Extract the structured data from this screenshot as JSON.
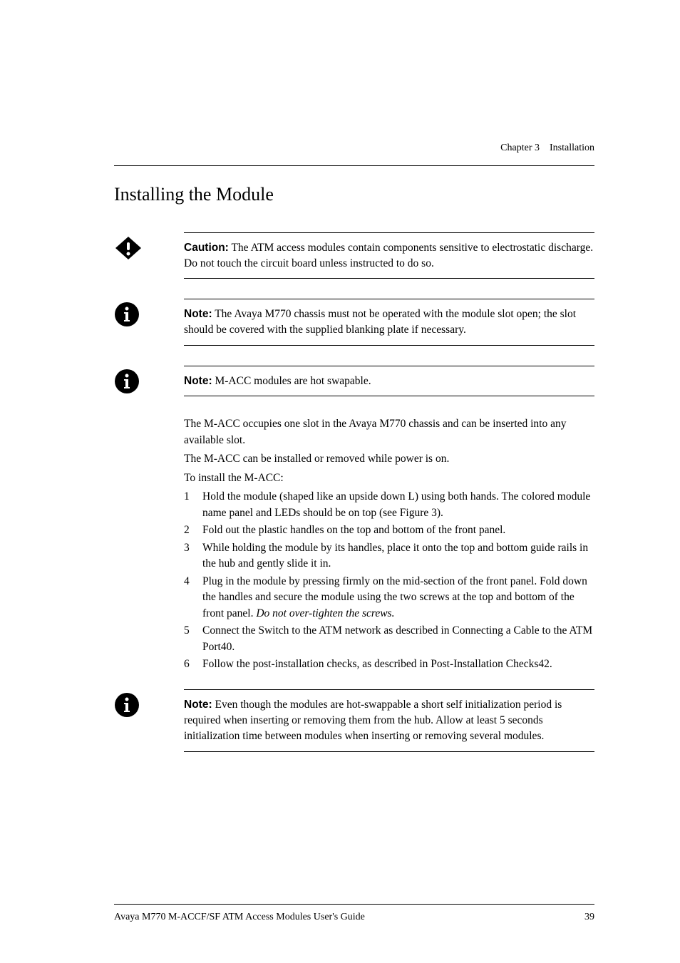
{
  "header": {
    "chapter": "Chapter 3",
    "title": "Installation"
  },
  "section": {
    "title": "Installing the Module"
  },
  "callouts": {
    "caution": {
      "label": "Caution:",
      "text": "The ATM access modules contain components sensitive to electrostatic discharge. Do not touch the circuit board unless instructed to do so."
    },
    "note1": {
      "label": "Note:",
      "text": "The Avaya M770 chassis must not be operated with the module slot open; the slot should be covered with the supplied blanking plate if necessary."
    },
    "note2": {
      "label": "Note:",
      "text": "M-ACC modules are hot swapable."
    },
    "note3": {
      "label": "Note:",
      "text": "Even though the modules are hot-swappable a short self initialization period is required when inserting or removing them from the hub. Allow at least 5 seconds initialization time between modules when inserting or removing several modules."
    }
  },
  "body": {
    "p1": "The M-ACC occupies one slot in the Avaya M770 chassis and can be inserted into any available slot.",
    "p2": "The M-ACC can be installed or removed while power is on.",
    "p3": "To install the M-ACC:"
  },
  "steps": [
    {
      "num": "1",
      "text": "Hold the module (shaped like an upside down L) using both hands. The colored module name panel and LEDs should be on top (see Figure 3)."
    },
    {
      "num": "2",
      "text": "Fold out the plastic handles on the top and bottom of the front panel."
    },
    {
      "num": "3",
      "text": "While holding the module by its handles, place it onto the top and bottom guide rails in the hub and gently slide it in."
    },
    {
      "num": "4",
      "text_a": "Plug in the module by pressing firmly on the mid-section of the front panel. Fold down the handles and secure the module using the two screws at the top and bottom of the front panel. ",
      "italic": "Do not over-tighten the screws."
    },
    {
      "num": "5",
      "text": "Connect the Switch to the ATM network as described in Connecting a Cable to the ATM Port40."
    },
    {
      "num": "6",
      "text": "Follow the post-installation checks, as described in Post-Installation Checks42."
    }
  ],
  "footer": {
    "left": "Avaya M770 M-ACCF/SF ATM Access Modules User's Guide",
    "right": "39"
  }
}
